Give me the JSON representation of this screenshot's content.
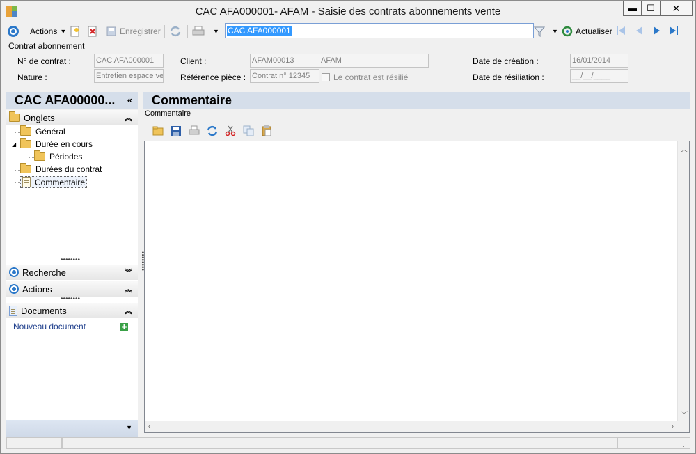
{
  "window": {
    "title": "CAC AFA000001- AFAM -  Saisie des contrats abonnements vente",
    "minimize_label": "▬",
    "maximize_label": "☐",
    "close_label": "✕"
  },
  "toolbar": {
    "actions_label": "Actions",
    "save_label": "Enregistrer",
    "search_value": "CAC AFA000001",
    "refresh_label": "Actualiser"
  },
  "form": {
    "group_label": "Contrat abonnement",
    "contract_no_label": "N° de contrat :",
    "contract_no_value": "CAC AFA000001",
    "nature_label": "Nature :",
    "nature_value": "Entretien espace ve",
    "client_label": "Client :",
    "client_code": "AFAM00013",
    "client_name": "AFAM",
    "reference_label": "Référence pièce :",
    "reference_value": "Contrat n° 12345",
    "terminated_label": "Le contrat  est résilié",
    "creation_date_label": "Date de création :",
    "creation_date_value": "16/01/2014",
    "termination_date_label": "Date de résiliation :",
    "termination_date_value": "__/__/____"
  },
  "left_panel": {
    "header": "CAC AFA00000...",
    "collapse_label": "«",
    "tabs_section": "Onglets",
    "tree": [
      "Général",
      "Durée en cours",
      "Périodes",
      "Durées du contrat",
      "Commentaire"
    ],
    "search_section": "Recherche",
    "actions_section": "Actions",
    "documents_section": "Documents",
    "new_document": "Nouveau document"
  },
  "right_panel": {
    "header": "Commentaire",
    "group_label": "Commentaire",
    "comment_text": ""
  },
  "colors": {
    "accent": "#2b78c9",
    "header_band": "#d5deea",
    "link": "#1f3f8c"
  }
}
